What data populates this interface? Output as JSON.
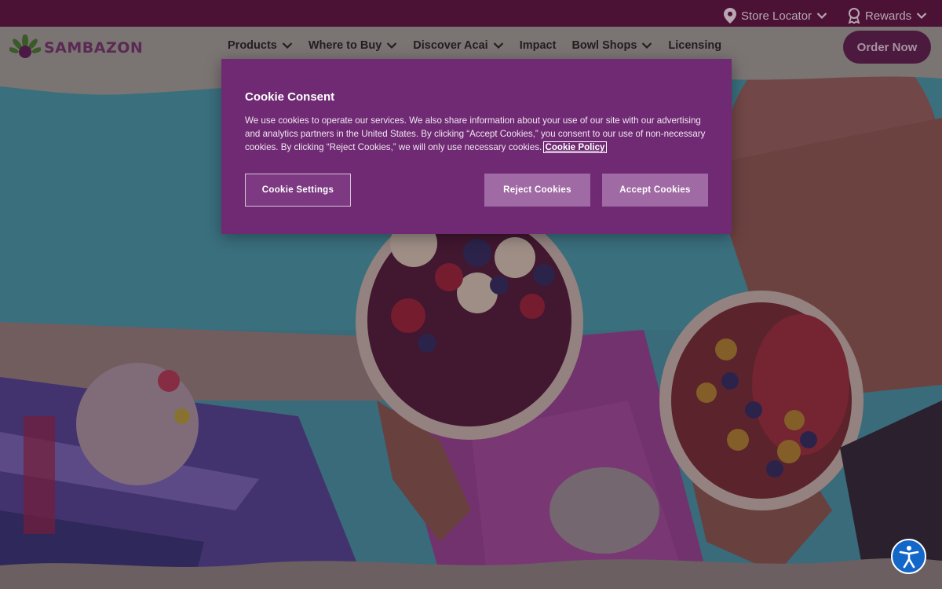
{
  "utility": {
    "store_locator": "Store Locator",
    "rewards": "Rewards"
  },
  "brand": {
    "name": "SAMBAZON"
  },
  "nav": {
    "items": [
      {
        "label": "Products",
        "dropdown": true
      },
      {
        "label": "Where to Buy",
        "dropdown": true
      },
      {
        "label": "Discover Acai",
        "dropdown": true
      },
      {
        "label": "Impact",
        "dropdown": false
      },
      {
        "label": "Bowl Shops",
        "dropdown": true
      },
      {
        "label": "Licensing",
        "dropdown": false
      }
    ],
    "order_now": "Order Now"
  },
  "cookie": {
    "title": "Cookie Consent",
    "body": "We use cookies to operate our services. We also share information about your use of our site with our advertising and analytics partners in the United States. By clicking “Accept Cookies,” you consent to our use of non-necessary cookies. By clicking “Reject Cookies,” we will only use necessary cookies.",
    "policy_link": "Cookie Policy",
    "settings_button": "Cookie Settings",
    "reject_button": "Reject Cookies",
    "accept_button": "Accept Cookies"
  },
  "colors": {
    "topbar": "#4b1235",
    "dialog": "#6f2a73",
    "accent_button": "#a06aa4",
    "order_button": "#4b1a3e",
    "a11y_button": "#1367c9"
  },
  "icons": {
    "store_locator": "map-pin-icon",
    "rewards": "award-ribbon-icon",
    "chevrons": "chevron-down-icon",
    "accessibility": "accessibility-person-icon"
  }
}
